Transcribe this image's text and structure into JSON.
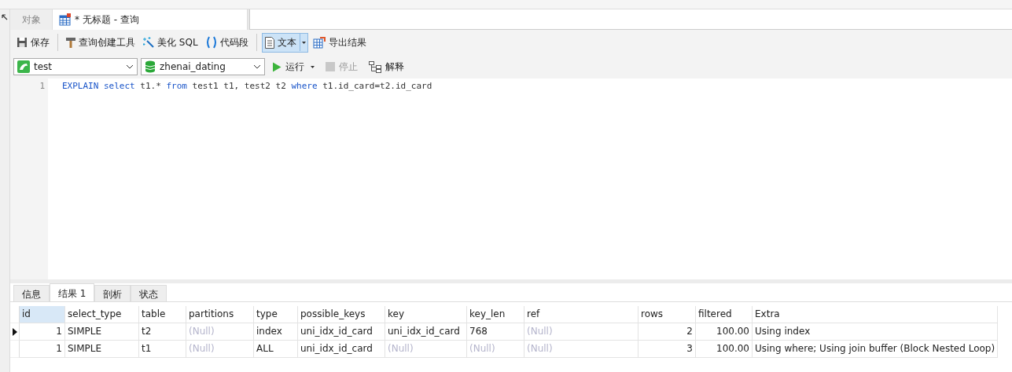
{
  "tabs": [
    {
      "label": "对象",
      "selected": false,
      "kind": "plain"
    },
    {
      "label": "* 无标题 - 查询",
      "selected": true,
      "kind": "query"
    }
  ],
  "toolbar": [
    {
      "label": "保存",
      "kind": "save",
      "pressed": false
    },
    {
      "label": "查询创建工具",
      "kind": "builder",
      "pressed": false
    },
    {
      "label": "美化 SQL",
      "kind": "beautify",
      "pressed": false
    },
    {
      "label": "代码段",
      "kind": "snippet",
      "pressed": false
    },
    {
      "label": "文本",
      "kind": "text",
      "pressed": true
    },
    {
      "label": "导出结果",
      "kind": "export",
      "pressed": false
    }
  ],
  "connection": {
    "value": "test"
  },
  "database": {
    "value": "zhenai_dating"
  },
  "actions": [
    {
      "label": "运行",
      "kind": "run",
      "disabled": false
    },
    {
      "label": "停止",
      "kind": "stop",
      "disabled": true
    },
    {
      "label": "解释",
      "kind": "explain",
      "disabled": false
    }
  ],
  "editor": {
    "lines": [
      {
        "number": "1",
        "tokens": [
          {
            "text": "EXPLAIN select ",
            "kind": "keyword"
          },
          {
            "text": "t1.* ",
            "kind": "plain"
          },
          {
            "text": "from ",
            "kind": "keyword"
          },
          {
            "text": "test1 t1, test2 t2 ",
            "kind": "plain"
          },
          {
            "text": "where ",
            "kind": "keyword"
          },
          {
            "text": "t1.id_card=t2.id_card",
            "kind": "plain"
          }
        ]
      }
    ]
  },
  "result_tabs": [
    {
      "label": "信息",
      "selected": false
    },
    {
      "label": "结果 1",
      "selected": true
    },
    {
      "label": "剖析",
      "selected": false
    },
    {
      "label": "状态",
      "selected": false
    }
  ],
  "table": {
    "columns": [
      {
        "label": "id",
        "kind": "number",
        "selected": true
      },
      {
        "label": "select_type",
        "kind": "text",
        "selected": false
      },
      {
        "label": "table",
        "kind": "text",
        "selected": false
      },
      {
        "label": "partitions",
        "kind": "text",
        "selected": false
      },
      {
        "label": "type",
        "kind": "text",
        "selected": false
      },
      {
        "label": "possible_keys",
        "kind": "text",
        "selected": false
      },
      {
        "label": "key",
        "kind": "text",
        "selected": false
      },
      {
        "label": "key_len",
        "kind": "text",
        "selected": false
      },
      {
        "label": "ref",
        "kind": "text",
        "selected": false
      },
      {
        "label": "rows",
        "kind": "number",
        "selected": false
      },
      {
        "label": "filtered",
        "kind": "number",
        "selected": false
      },
      {
        "label": "Extra",
        "kind": "text",
        "selected": false
      }
    ],
    "rows": [
      {
        "selected": true,
        "cells": [
          {
            "text": "1",
            "is_null": false
          },
          {
            "text": "SIMPLE",
            "is_null": false
          },
          {
            "text": "t2",
            "is_null": false
          },
          {
            "text": "(Null)",
            "is_null": true
          },
          {
            "text": "index",
            "is_null": false
          },
          {
            "text": "uni_idx_id_card",
            "is_null": false
          },
          {
            "text": "uni_idx_id_card",
            "is_null": false
          },
          {
            "text": "768",
            "is_null": false
          },
          {
            "text": "(Null)",
            "is_null": true
          },
          {
            "text": "2",
            "is_null": false
          },
          {
            "text": "100.00",
            "is_null": false
          },
          {
            "text": "Using index",
            "is_null": false
          }
        ]
      },
      {
        "selected": false,
        "cells": [
          {
            "text": "1",
            "is_null": false
          },
          {
            "text": "SIMPLE",
            "is_null": false
          },
          {
            "text": "t1",
            "is_null": false
          },
          {
            "text": "(Null)",
            "is_null": true
          },
          {
            "text": "ALL",
            "is_null": false
          },
          {
            "text": "uni_idx_id_card",
            "is_null": false
          },
          {
            "text": "(Null)",
            "is_null": true
          },
          {
            "text": "(Null)",
            "is_null": true
          },
          {
            "text": "(Null)",
            "is_null": true
          },
          {
            "text": "3",
            "is_null": false
          },
          {
            "text": "100.00",
            "is_null": false
          },
          {
            "text": "Using where; Using join buffer (Block Nested Loop)",
            "is_null": false
          }
        ]
      }
    ]
  }
}
